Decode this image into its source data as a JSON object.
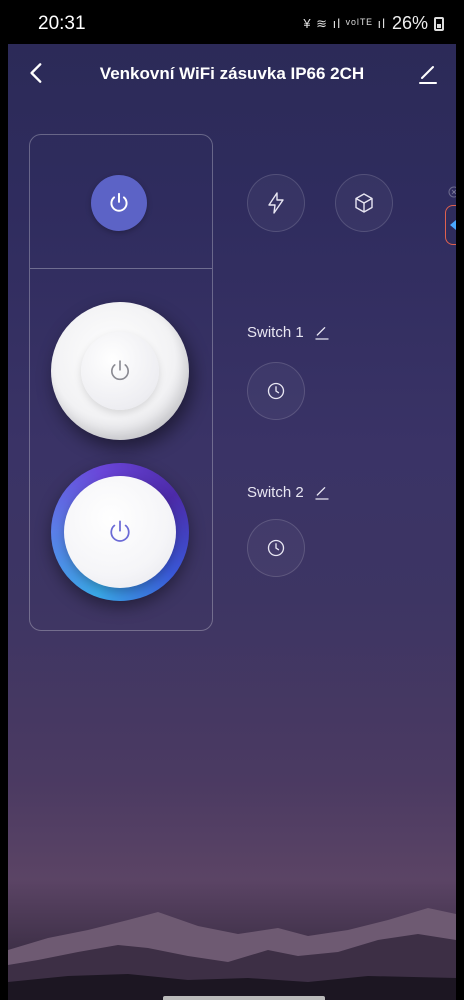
{
  "status": {
    "time": "20:31",
    "icons": "¥ ≋ ıl ᵛᵒˡᵀᴱ ıl",
    "battery": "26%"
  },
  "header": {
    "title": "Venkovní WiFi zásuvka IP66 2CH"
  },
  "switches": [
    {
      "label": "Switch 1",
      "state": "off"
    },
    {
      "label": "Switch 2",
      "state": "on"
    }
  ],
  "colors": {
    "accent": "#5c63c6",
    "on_ring_start": "#3aa9e8",
    "on_ring_end": "#6a45d8",
    "side_tab_border": "#e0614f"
  },
  "icons": [
    "back-icon",
    "edit-icon",
    "power-icon",
    "lightning-icon",
    "cube-icon",
    "clock-icon",
    "pencil-icon",
    "close-icon",
    "chevron-left-icon"
  ]
}
